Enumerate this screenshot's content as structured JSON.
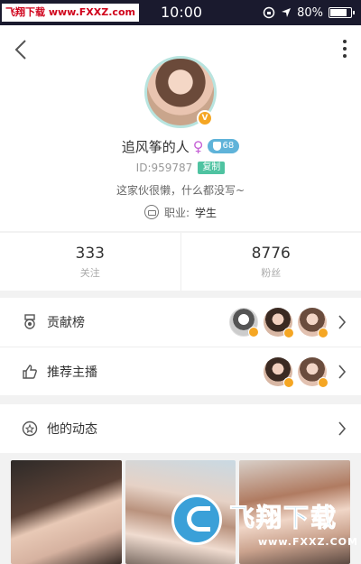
{
  "status_bar": {
    "watermark": "飞翔下载 www.FXXZ.com",
    "time": "10:00",
    "battery_text": "80%",
    "battery_level": 0.8
  },
  "profile": {
    "name": "追风筝的人",
    "gender_symbol": "♀",
    "level": "68",
    "id_text": "ID:959787",
    "copy_label": "复制",
    "bio": "这家伙很懒，什么都没写~",
    "job_label": "职业:",
    "job_value": "学生",
    "avatar_badge": "V"
  },
  "stats": {
    "following_count": "333",
    "following_label": "关注",
    "fans_count": "8776",
    "fans_label": "粉丝"
  },
  "list": {
    "contribution_label": "贡献榜",
    "recommend_label": "推荐主播",
    "feed_label": "他的动态"
  },
  "watermark": {
    "brand": "飞翔下载",
    "url": "www.FXXZ.COM"
  }
}
